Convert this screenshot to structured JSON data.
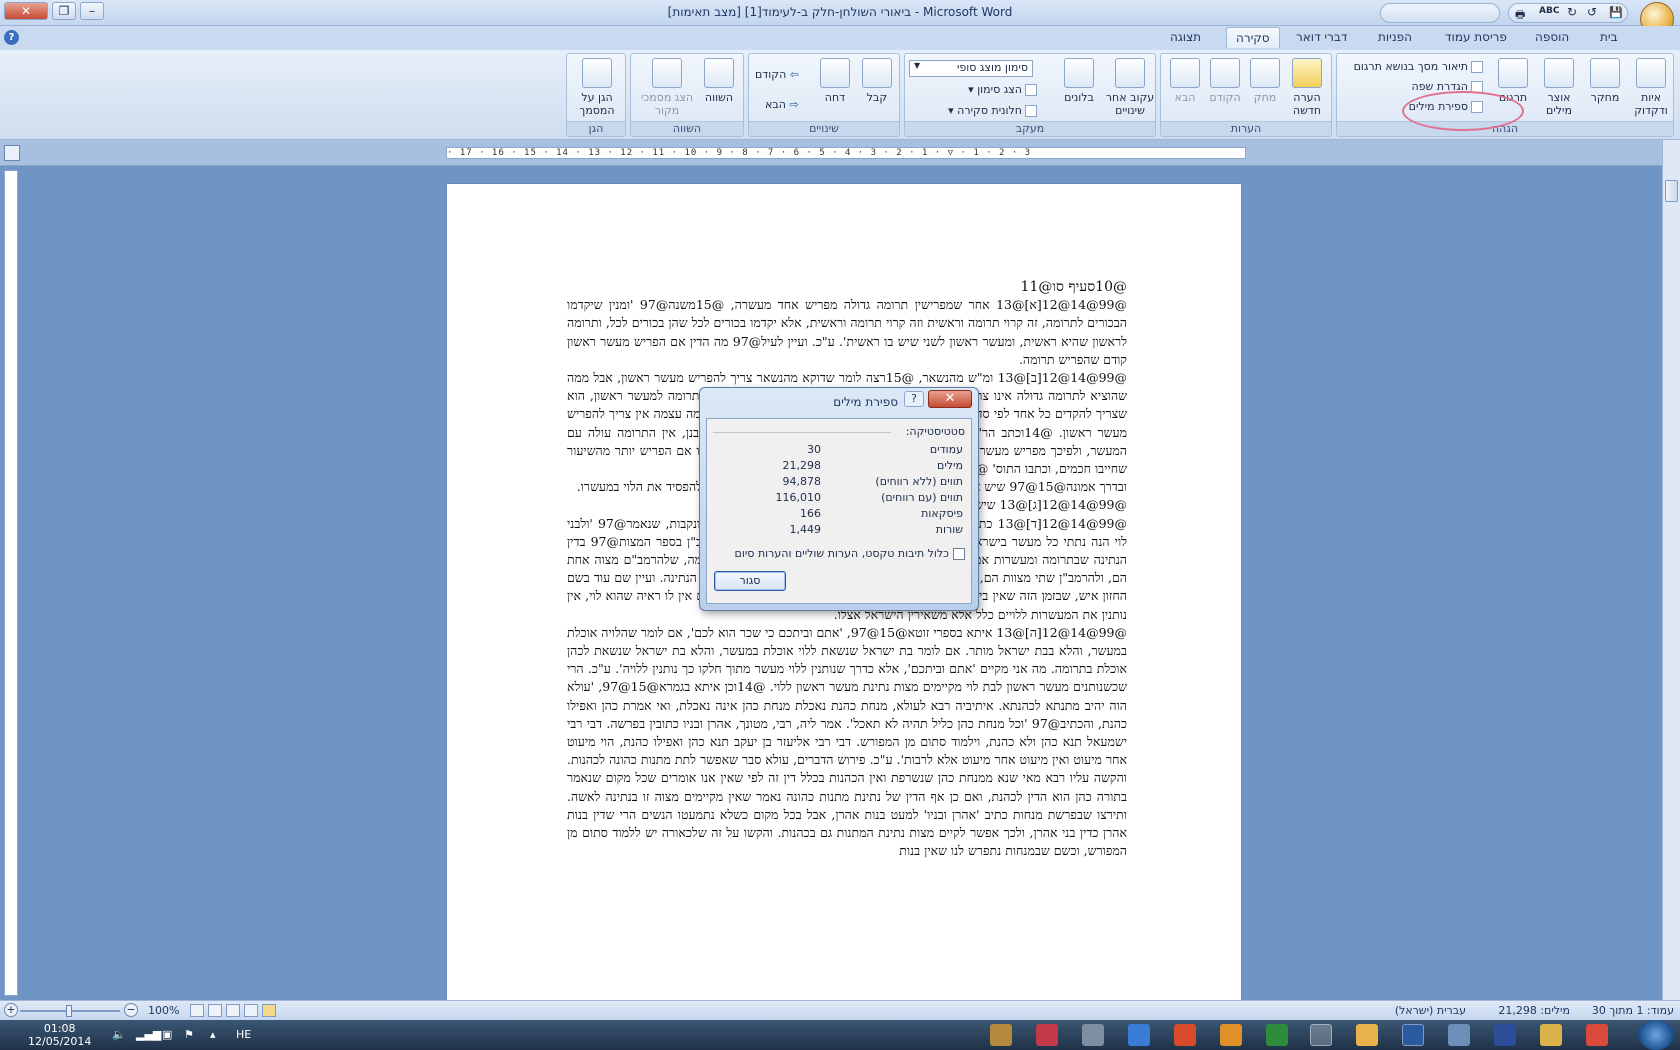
{
  "window": {
    "title": "ביאורי השולחן-חלק ב-לעימוד[1] [מצב תאימות] - Microsoft Word"
  },
  "tabs": [
    "בית",
    "הוספה",
    "פריסת עמוד",
    "הפניות",
    "דברי דואר",
    "סקירה",
    "תצוגה"
  ],
  "active_tab": "סקירה",
  "ribbon": {
    "proofing": {
      "label": "הגהה",
      "spelling": "איות ודקדוק",
      "research": "מחקר",
      "thesaurus": "אוצר מילים",
      "translate": "תרגום",
      "translation_tooltip": "תיאור מסך בנושא תרגום",
      "set_language": "הגדרת שפה",
      "word_count": "ספירת מילים"
    },
    "comments": {
      "label": "הערות",
      "new_comment": "הערה חדשה",
      "delete": "מחק",
      "previous": "הקודם",
      "next": "הבא"
    },
    "tracking": {
      "label": "מעקב",
      "track_changes": "עקוב אחר שינויים",
      "balloons": "בלונים",
      "display_for_review": "סימון מוצג סופי",
      "show_markup": "הצג סימון",
      "reviewing_pane": "חלונית סקירה"
    },
    "changes": {
      "label": "שינויים",
      "accept": "קבל",
      "reject": "דחה",
      "previous": "הקודם",
      "next": "הבא"
    },
    "compare": {
      "label": "השווה",
      "compare": "השווה",
      "show_source": "הצג מסמכי מקור"
    },
    "protect": {
      "label": "הגן",
      "protect_document": "הגן על המסמך"
    }
  },
  "document": {
    "paragraphs": [
      "@10סעיף סו@11",
      "@99@14@12[א]@13 אחר שמפרישין תרומה גדולה מפריש אחד מעשרה, @15משנה@97 'ומנין שיקדמו הבכורים לתרומה, זה קרוי תרומה וראשית וזה קרוי תרומה וראשית, אלא יקדמו בכורים לכל שהן בכורים לכל, ותרומה לראשון שהיא ראשית, ומעשר ראשון לשני שיש בו ראשית'. ע\"כ. ועיין לעיל@97 מה הדין אם הפריש מעשר ראשון קודם שהפריש תרומה.",
      "@99@14@12[ב]@13 ומ\"ש מהנשאר, @15רצה לומר שדוקא מהנשאר צריך להפריש מעשר ראשון, אבל ממה שהוציא לתרומה גדולה אינו צריך להפריש, ודין זה נלמד ממה שאמרו בירושלמי @97, תרומה למעשר ראשון, הוא שצריך להקדים כל אחד לפי סדרו ולא יקדים את חבירו, וכגון תרומה גדולה, אבל מן התרומה עצמה אין צריך להפריש מעשר ראשון. @14וכתב הר\"ש@15@97, שיש אומרים שאינו צריך ליתן אלא מדרבנן, אין התרומה עולה עם המעשר, ולפיכך מפריש מעשר ראשון אף על התרומה שהפריש יותר מחטה אחת, ואפילו אם הפריש יותר מהשיעור שחייבו חכמים, וכתבו התוס' @97.",
      "ובדרך אמונה@15@97 שיש אחריו מעשר שני או מעשר עני, ואחד מארבעים כדי שלא להפסיד את הלוי במעשרו.",
      "@99@14@12[ג]@13 שיש אחריו מעשר שני או מעשר עני.",
      "@99@14@12[ד]@13 כתב הרמב\"ם@15@97 וז\"ל, 'והמעשר הזה ללויים זכרים ונקבות, שנאמר@97 'ולבני לוי הנה נתתי כל מעשר בישראל לנחלה'. ע\"כ. ועיין לעיל@97 שנחלקו הרמב\"ם והרמב\"ן בספר המצות@97 בדין הנתינה שבתרומה ומעשרות אם היא חלק ממצוה של ההפרשה או שהיא מצוה בפני עצמה, שלהרמב\"ם מצוה אחת הם, ולהרמב\"ן שתי מצוות הם, ועיין שם שאף לדעת הרמב\"ן שתי מצות הם אין לברך על הנתינה. ועיין שם עוד בשם החזון איש, שבזמן הזה שאין בית דין שימנע מכל אחד הטוען שהוא לוי מלעלות לתורה אם אין לו ראיה שהוא לוי, אין נותנין את המעשרות ללויים כלל אלא משאירין הישראל אצלו.",
      "@99@14@12[ה]@13 איתא בספרי זוטא@15@97, 'אתם וביתכם כי שכר הוא לכם', אם לומר שהלויה אוכלת במעשר, והלא בבת ישראל מותר. אם לומר בת ישראל שנשאת ללוי אוכלת במעשר, והלא בת ישראל שנשאת לכהן אוכלת בתרומה. מה אני מקיים 'אתם וביתכם', אלא כדרך שנותנין ללוי מעשר מתוך חלקו כך נותנין ללויה'. ע\"כ. הרי שכשנותנים מעשר ראשון לבת לוי מקיימים מצות נתינת מעשר ראשון ללוי. @14וכן איתא בגמרא@15@97, 'עולא הוה יהיב מתנתא לכהנתא. איתיביה רבא לעולא, מנחת כהנת נאכלת מנחת כהן אינה נאכלת, ואי אמרת כהן ואפילו כהנת, והכתיב@97 'וכל מנחת כהן כליל תהיה לא תאכל'. אמר ליה, רבי, מטונך, אהרן ובניו כתובין בפרשה. דבי רבי ישמעאל תנא כהן ולא כהנת, וילמוד סתום מן המפורש. דבי רבי אליעזר בן יעקב תנא כהן ואפילו כהנת, הוי מיעוט אחר מיעוט ואין מיעוט אחר מיעוט אלא לרבות'. ע\"כ. פירוש הדברים, עולא סבר שאפשר לתת מתנות כהונה לכהנות. והקשה עליו רבא מאי שנא ממנחת כהן שנשרפת ואין הכהנות בכלל דין זה לפי שאין אנו אומרים שכל מקום שנאמר בתורה כהן הוא הדין לכהנת, ואם כן אף הדין של נתינת מתנות כהונה נאמר שאין מקיימים מצוה זו בנתינה לאשה. ותירצו שבפרשת מנחות כתיב 'אהרן ובניו' למעט בנות אהרן, אבל בכל מקום כשלא נתמעטו הנשים הרי שדין בנות אהרן כדין בני אהרן, ולכך אפשר לקיים מצות נתינת המתנות גם בכהנות. והקשו על זה שלכאורה יש ללמוד סתום מן המפורש, וכשם שבמנחות נתפרש לנו שאין בנות"
    ]
  },
  "dialog": {
    "title": "ספירת מילים",
    "section": "סטטיסטיקה:",
    "rows": [
      {
        "label": "עמודים",
        "value": "30"
      },
      {
        "label": "מילים",
        "value": "21,298"
      },
      {
        "label": "תווים (ללא רווחים)",
        "value": "94,878"
      },
      {
        "label": "תווים (עם רווחים)",
        "value": "116,010"
      },
      {
        "label": "פיסקאות",
        "value": "166"
      },
      {
        "label": "שורות",
        "value": "1,449"
      }
    ],
    "checkbox_label": "כלול תיבות טקסט, הערות שוליים והערות סיום",
    "checkbox_checked": false,
    "close_button": "סגור"
  },
  "statusbar": {
    "page": "עמוד: 1 מתוך 30",
    "words": "מילים: 21,298",
    "language": "עברית (ישראל)",
    "zoom": "100%"
  },
  "taskbar": {
    "time": "01:08",
    "date": "12/05/2014",
    "lang": "HE"
  },
  "colors": {
    "annotation_circle": "#e07090",
    "title_bar": "#c2d6ef",
    "taskbar": "#1f3248"
  }
}
